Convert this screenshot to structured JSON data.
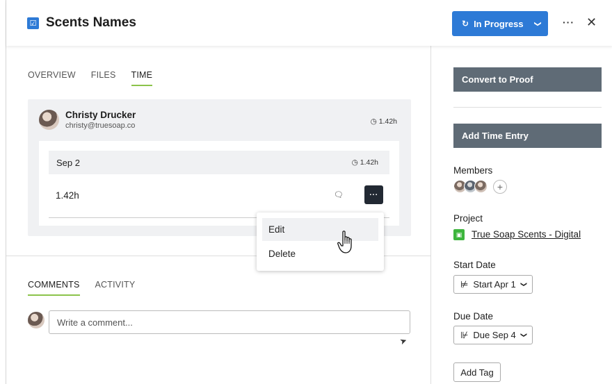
{
  "header": {
    "title": "Scents Names",
    "status_label": "In Progress",
    "more_label": "···",
    "close_label": "✕"
  },
  "tabs": [
    {
      "label": "OVERVIEW",
      "active": false
    },
    {
      "label": "FILES",
      "active": false
    },
    {
      "label": "TIME",
      "active": true
    }
  ],
  "time": {
    "user_name": "Christy Drucker",
    "user_email": "christy@truesoap.co",
    "user_total": "1.42h",
    "date_label": "Sep 2",
    "date_total": "1.42h",
    "entry_hours": "1.42h",
    "entry_menu_label": "···"
  },
  "menu": {
    "items": [
      {
        "label": "Edit",
        "hover": true
      },
      {
        "label": "Delete",
        "hover": false
      }
    ]
  },
  "comments": {
    "tabs": [
      {
        "label": "COMMENTS",
        "active": true
      },
      {
        "label": "ACTIVITY",
        "active": false
      }
    ],
    "placeholder": "Write a comment..."
  },
  "sidebar": {
    "convert_label": "Convert to Proof",
    "add_time_label": "Add Time Entry",
    "members_label": "Members",
    "project_label": "Project",
    "project_name": "True Soap Scents - Digital",
    "start_label": "Start Date",
    "start_value": "Start Apr 1",
    "due_label": "Due Date",
    "due_value": "Due Sep 4",
    "add_tag_label": "Add Tag"
  },
  "colors": {
    "primary": "#2d7ad6",
    "tab_underline": "#8bc34a",
    "dark_button": "#5f6b76",
    "project_green": "#3db53d"
  }
}
